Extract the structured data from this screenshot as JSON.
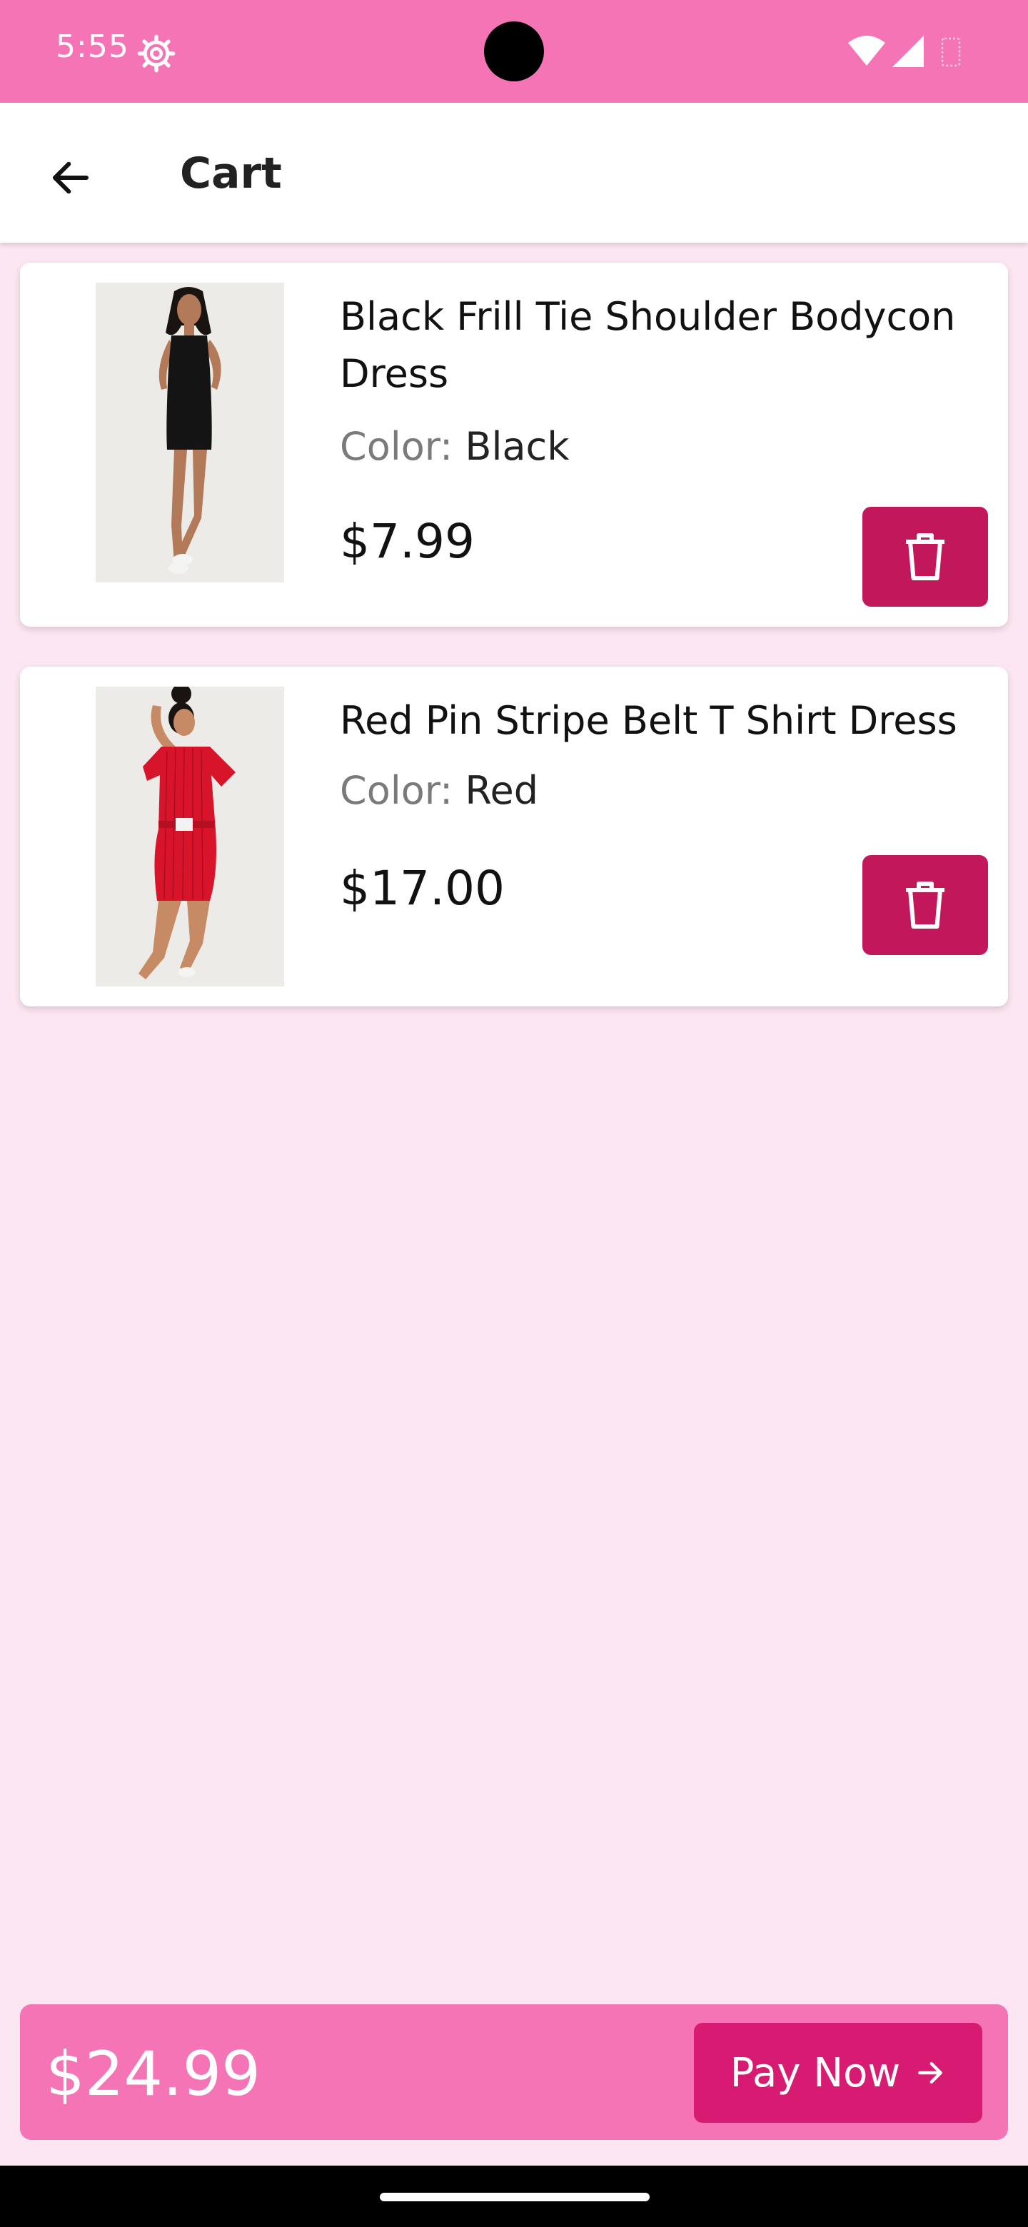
{
  "status_bar": {
    "time": "5:55"
  },
  "header": {
    "title": "Cart"
  },
  "cart_items": [
    {
      "name": "Black Frill Tie Shoulder Bodycon Dress",
      "color_label": "Color:",
      "color_value": "Black",
      "price": "$7.99"
    },
    {
      "name": "Red Pin Stripe Belt T Shirt Dress",
      "color_label": "Color:",
      "color_value": "Red",
      "price": "$17.00"
    }
  ],
  "checkout": {
    "total": "$24.99",
    "pay_label": "Pay Now"
  },
  "colors": {
    "accent": "#f574b5",
    "primary": "#c2185b",
    "background": "#fce6f2"
  }
}
